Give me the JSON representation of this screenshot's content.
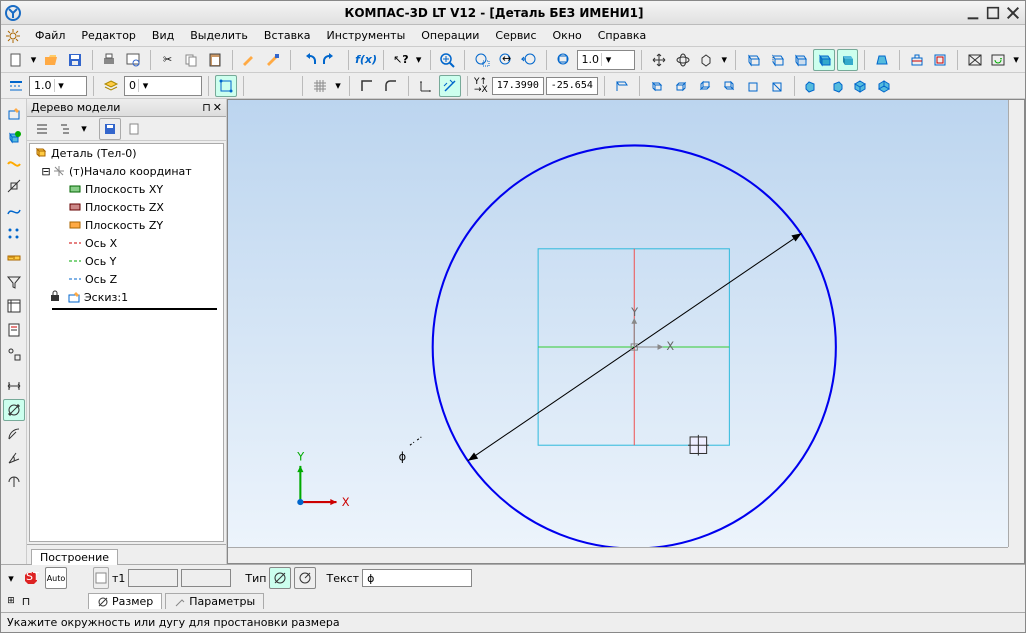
{
  "window": {
    "title": "КОМПАС-3D LT V12 - [Деталь БЕЗ ИМЕНИ1]"
  },
  "menu": {
    "items": [
      "Файл",
      "Редактор",
      "Вид",
      "Выделить",
      "Вставка",
      "Инструменты",
      "Операции",
      "Сервис",
      "Окно",
      "Справка"
    ]
  },
  "toolbar2": {
    "value1": "1.0",
    "value2": "0"
  },
  "toolbar2b": {
    "zoom": "1.0",
    "coord_x": "17.3990",
    "coord_y": "-25.654"
  },
  "tree": {
    "title": "Дерево модели",
    "root": "Деталь (Тел-0)",
    "origin": "(т)Начало координат",
    "items": [
      "Плоскость XY",
      "Плоскость ZX",
      "Плоскость ZY",
      "Ось X",
      "Ось Y",
      "Ось Z"
    ],
    "sketch": "Эскиз:1",
    "tab": "Построение"
  },
  "axes": {
    "x": "X",
    "y": "Y"
  },
  "origin_axes": {
    "x": "X",
    "y": "Y"
  },
  "diameter": {
    "symbol": "ϕ"
  },
  "props": {
    "t1_label": "т1",
    "type_label": "Тип",
    "text_label": "Текст",
    "text_value": "ϕ",
    "tab_dim": "Размер",
    "tab_params": "Параметры"
  },
  "status": {
    "text": "Укажите окружность или дугу для простановки размера"
  }
}
